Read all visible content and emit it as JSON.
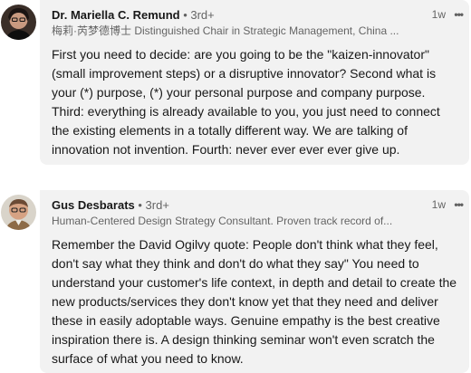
{
  "comments": [
    {
      "name": "Dr. Mariella C. Remund",
      "degree": " • 3rd+",
      "headline": "梅莉·芮梦德博士 Distinguished Chair in Strategic Management, China ...",
      "time": "1w",
      "more_icon": "ellipsis-icon",
      "text": "First you need to decide: are you going to be the \"kaizen-innovator\" (small improvement steps) or a disruptive innovator? Second what is your (*) purpose, (*) your personal purpose and company purpose. Third: everything is already available to you, you just need to connect the existing elements in a totally different way. We are talking of innovation not invention. Fourth: never ever ever ever give up."
    },
    {
      "name": "Gus Desbarats",
      "degree": " • 3rd+",
      "headline": "Human-Centered Design Strategy Consultant. Proven track record of...",
      "time": "1w",
      "more_icon": "ellipsis-icon",
      "text": "Remember the David Ogilvy quote: People don't think what they feel, don't say what they think and don't do what they say\" You need to understand your customer's life context, in depth and detail to create the new products/services they don't know yet that they need and deliver these in easily adoptable ways. Genuine empathy is the best creative inspiration there is. A design thinking seminar won't even scratch the surface of what you need to know."
    }
  ],
  "colors": {
    "bubble": "#f2f2f2",
    "text": "#191919",
    "secondary": "#666666"
  }
}
